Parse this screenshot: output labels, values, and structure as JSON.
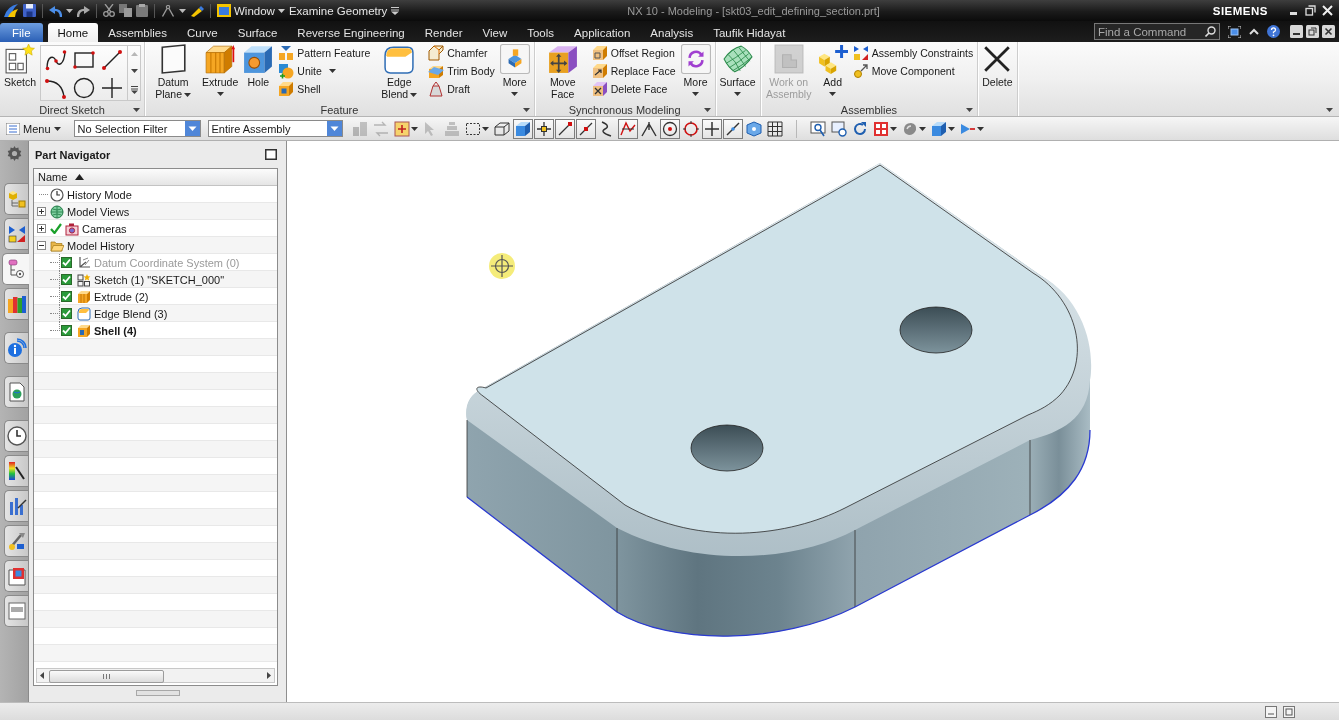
{
  "title_bar": {
    "window_menu": "Window",
    "quick_command": "Examine Geometry",
    "title": "NX 10 - Modeling - [skt03_edit_defining_section.prt]",
    "brand": "SIEMENS"
  },
  "tabs": [
    {
      "label": "File",
      "kind": "file",
      "selected": false
    },
    {
      "label": "Home",
      "kind": "tab",
      "selected": true
    },
    {
      "label": "Assemblies",
      "kind": "tab",
      "selected": false
    },
    {
      "label": "Curve",
      "kind": "tab",
      "selected": false
    },
    {
      "label": "Surface",
      "kind": "tab",
      "selected": false
    },
    {
      "label": "Reverse Engineering",
      "kind": "tab",
      "selected": false
    },
    {
      "label": "Render",
      "kind": "tab",
      "selected": false
    },
    {
      "label": "View",
      "kind": "tab",
      "selected": false
    },
    {
      "label": "Tools",
      "kind": "tab",
      "selected": false
    },
    {
      "label": "Application",
      "kind": "tab",
      "selected": false
    },
    {
      "label": "Analysis",
      "kind": "tab",
      "selected": false
    },
    {
      "label": "Taufik Hidayat",
      "kind": "tab",
      "selected": false
    }
  ],
  "command_search": {
    "placeholder": "Find a Command"
  },
  "ribbon": {
    "groups": [
      {
        "label": "Direct Sketch",
        "dropdown": true,
        "items": [
          {
            "kind": "large",
            "label": "Sketch",
            "dropdown": false,
            "disabled": false
          },
          {
            "kind": "gallery"
          }
        ]
      },
      {
        "label": "Feature",
        "dropdown": true,
        "items": [
          {
            "kind": "large",
            "label": "Datum Plane",
            "dropdown": true,
            "disabled": false
          },
          {
            "kind": "large",
            "label": "Extrude",
            "dropdown": true,
            "disabled": false
          },
          {
            "kind": "large",
            "label": "Hole",
            "dropdown": false,
            "disabled": false
          },
          {
            "kind": "stack",
            "items": [
              {
                "label": "Pattern Feature",
                "dropdown": false
              },
              {
                "label": "Unite",
                "dropdown": true
              },
              {
                "label": "Shell",
                "dropdown": false
              }
            ]
          },
          {
            "kind": "large",
            "label": "Edge Blend",
            "dropdown": true,
            "disabled": false
          },
          {
            "kind": "stack",
            "items": [
              {
                "label": "Chamfer",
                "dropdown": false
              },
              {
                "label": "Trim Body",
                "dropdown": false
              },
              {
                "label": "Draft",
                "dropdown": false
              }
            ]
          },
          {
            "kind": "more",
            "label": "More",
            "dropdown": true,
            "disabled": false
          }
        ]
      },
      {
        "label": "Synchronous Modeling",
        "dropdown": true,
        "items": [
          {
            "kind": "large",
            "label": "Move Face",
            "dropdown": false,
            "disabled": false
          },
          {
            "kind": "stack",
            "items": [
              {
                "label": "Offset Region",
                "dropdown": false
              },
              {
                "label": "Replace Face",
                "dropdown": false
              },
              {
                "label": "Delete Face",
                "dropdown": false
              }
            ]
          },
          {
            "kind": "more",
            "label": "More",
            "dropdown": true,
            "disabled": false
          }
        ]
      },
      {
        "dropdown": false,
        "items": [
          {
            "kind": "large",
            "label": "Surface",
            "dropdown": true,
            "disabled": false
          }
        ]
      },
      {
        "label": "Assemblies",
        "dropdown": true,
        "items": [
          {
            "kind": "large",
            "label": "Work on Assembly",
            "dropdown": false,
            "disabled": true
          },
          {
            "kind": "large",
            "label": "Add",
            "dropdown": true,
            "disabled": false
          },
          {
            "kind": "stack",
            "items": [
              {
                "label": "Assembly Constraints",
                "dropdown": false
              },
              {
                "label": "Move Component",
                "dropdown": false
              }
            ]
          }
        ]
      },
      {
        "dropdown": false,
        "items": [
          {
            "kind": "large",
            "label": "Delete",
            "dropdown": false,
            "disabled": false
          }
        ]
      }
    ]
  },
  "toolbar": {
    "menu": "Menu",
    "selection_filter": "No Selection Filter",
    "assembly_scope": "Entire Assembly",
    "tools": [
      {
        "on": false,
        "disabled": true,
        "dropdown": false
      },
      {
        "on": false,
        "disabled": true,
        "dropdown": false
      },
      {
        "on": false,
        "disabled": false,
        "dropdown": true
      },
      {
        "on": false,
        "disabled": true,
        "dropdown": false
      },
      {
        "on": false,
        "disabled": true,
        "dropdown": false
      },
      {
        "on": false,
        "disabled": false,
        "dropdown": true
      },
      {
        "on": false,
        "disabled": false,
        "dropdown": false
      },
      {
        "on": true,
        "disabled": false,
        "dropdown": false
      },
      {
        "on": true,
        "disabled": false,
        "dropdown": false
      },
      {
        "on": true,
        "disabled": false,
        "dropdown": false
      },
      {
        "on": true,
        "disabled": false,
        "dropdown": false
      },
      {
        "on": false,
        "disabled": false,
        "dropdown": false
      },
      {
        "on": true,
        "disabled": false,
        "dropdown": false
      },
      {
        "on": false,
        "disabled": false,
        "dropdown": false
      },
      {
        "on": true,
        "disabled": false,
        "dropdown": false
      },
      {
        "on": false,
        "disabled": false,
        "dropdown": false
      },
      {
        "on": true,
        "disabled": false,
        "dropdown": false
      },
      {
        "on": true,
        "disabled": false,
        "dropdown": false
      },
      {
        "on": false,
        "disabled": false,
        "dropdown": false
      },
      {
        "on": false,
        "disabled": false,
        "dropdown": false
      },
      {
        "on": false,
        "disabled": false,
        "dropdown": false
      },
      {
        "on": false,
        "disabled": false,
        "dropdown": false
      },
      {
        "on": false,
        "disabled": false,
        "dropdown": false
      },
      {
        "on": false,
        "disabled": false,
        "dropdown": true
      },
      {
        "on": false,
        "disabled": false,
        "dropdown": true
      },
      {
        "on": false,
        "disabled": false,
        "dropdown": true
      },
      {
        "on": false,
        "disabled": false,
        "dropdown": true
      }
    ]
  },
  "resource_tabs": [
    {
      "selected": false
    },
    {
      "selected": false
    },
    {
      "selected": true
    },
    {
      "selected": false
    },
    {
      "selected": false
    },
    {
      "selected": false
    },
    {
      "selected": false
    },
    {
      "selected": false
    },
    {
      "selected": false
    },
    {
      "selected": false
    },
    {
      "selected": false
    },
    {
      "selected": false
    }
  ],
  "part_navigator": {
    "title": "Part Navigator",
    "column": {
      "label": "Name",
      "sort_ascending": true
    },
    "nodes": [
      {
        "label": "History Mode",
        "ticked": false
      },
      {
        "label": "Model Views",
        "expanded": false,
        "ticked": false
      },
      {
        "label": "Cameras",
        "expanded": false,
        "ticked": true
      },
      {
        "label": "Model History",
        "expanded": true,
        "ticked": false,
        "children": [
          {
            "label": "Datum Coordinate System (0)",
            "checked": true,
            "dimmed": true,
            "current": false
          },
          {
            "label": "Sketch (1) \"SKETCH_000\"",
            "checked": true,
            "dimmed": false,
            "current": false
          },
          {
            "label": "Extrude (2)",
            "checked": true,
            "dimmed": false,
            "current": false
          },
          {
            "label": "Edge Blend (3)",
            "checked": true,
            "dimmed": false,
            "current": false
          },
          {
            "label": "Shell (4)",
            "checked": true,
            "dimmed": false,
            "current": true
          }
        ]
      }
    ]
  }
}
